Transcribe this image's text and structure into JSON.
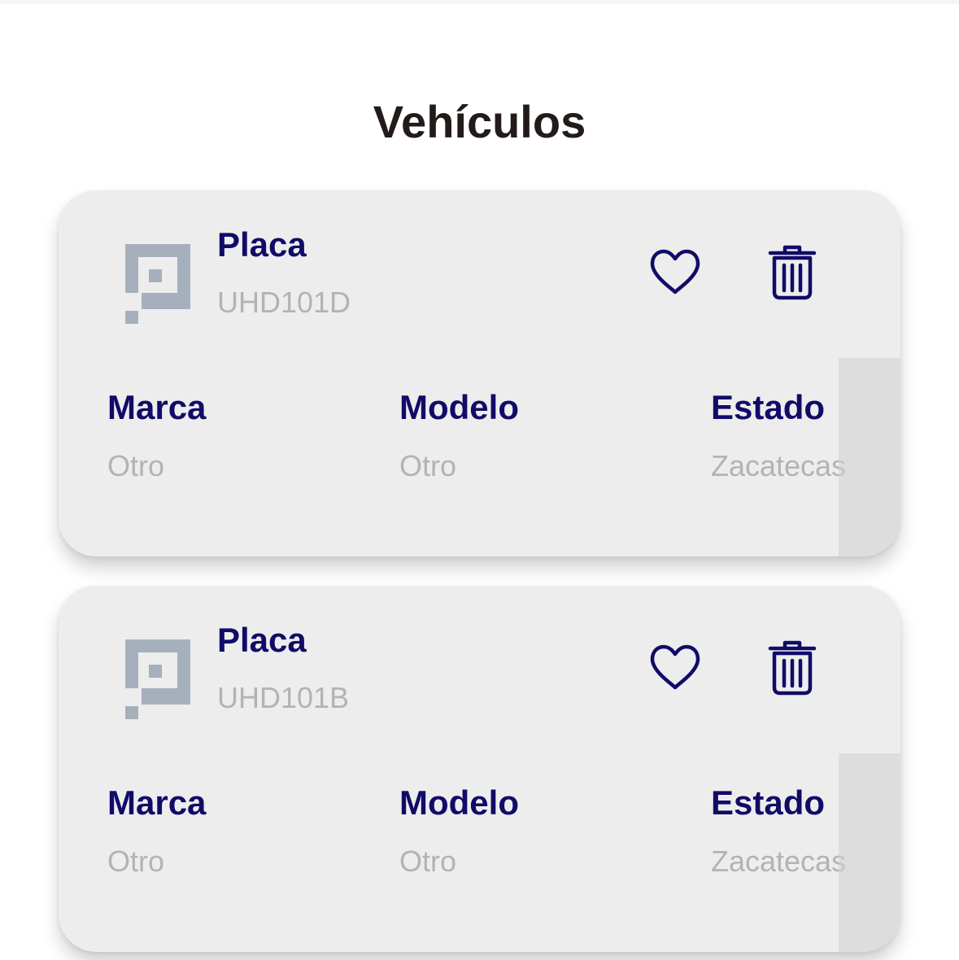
{
  "header": {
    "title": "Vehículos"
  },
  "vehicles": [
    {
      "plate_label": "Placa",
      "plate": "UHD101D",
      "brand_label": "Marca",
      "brand": "Otro",
      "model_label": "Modelo",
      "model": "Otro",
      "state_label": "Estado",
      "state": "Zacatecas",
      "favorite_icon": "heart-outline-icon",
      "delete_icon": "trash-icon"
    },
    {
      "plate_label": "Placa",
      "plate": "UHD101B",
      "brand_label": "Marca",
      "brand": "Otro",
      "model_label": "Modelo",
      "model": "Otro",
      "state_label": "Estado",
      "state": "Zacatecas",
      "favorite_icon": "heart-outline-icon",
      "delete_icon": "trash-icon"
    }
  ],
  "colors": {
    "title": "#221b19",
    "label": "#110b68",
    "value": "#b3b3b3",
    "card": "#ededed",
    "icon": "#110b68",
    "plate_icon": "#a6b0bd"
  }
}
